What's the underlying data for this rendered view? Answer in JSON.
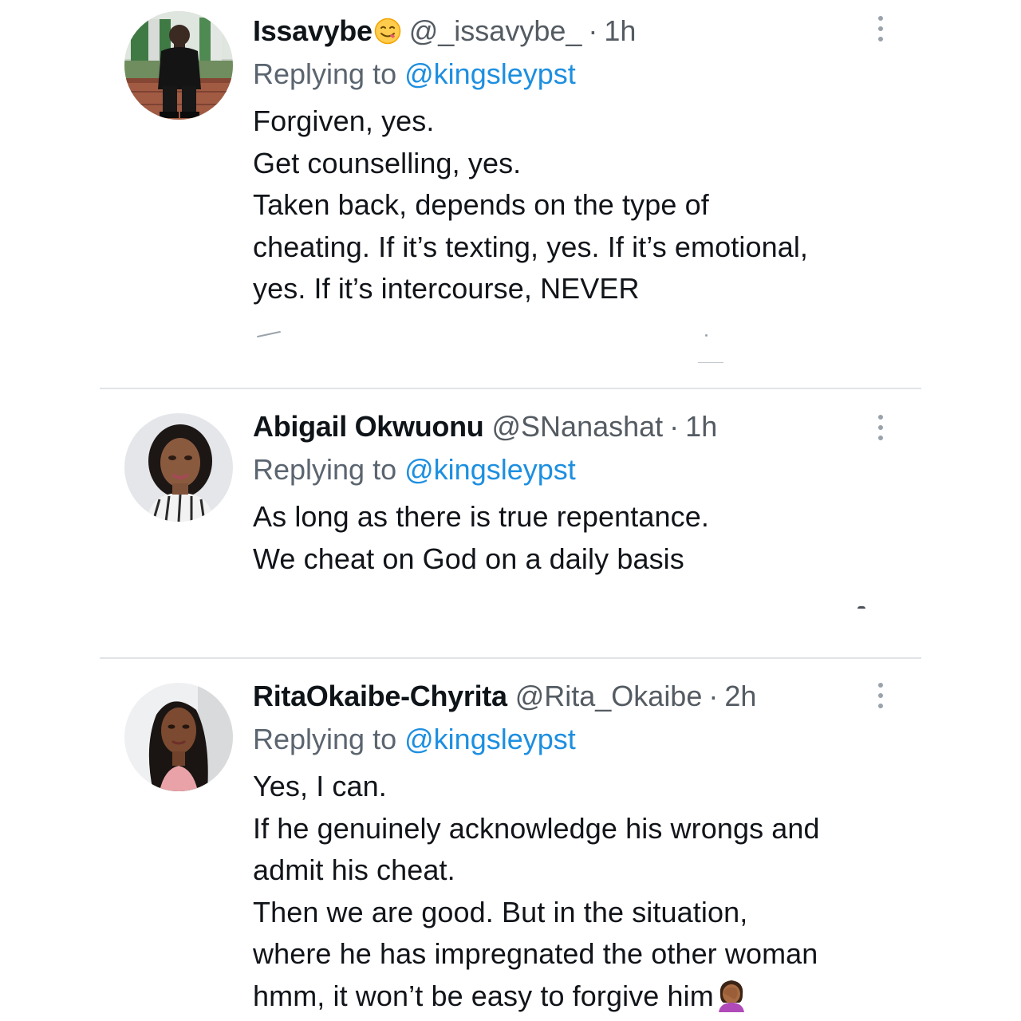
{
  "tweets": [
    {
      "display_name": "Issavybe",
      "name_emoji": "face-savoring-food-emoji",
      "handle": "@_issavybe_",
      "separator": "·",
      "time": "1h",
      "reply_prefix": "Replying to",
      "reply_target": "@kingsleypst",
      "body": [
        "Forgiven, yes.",
        "Get counselling, yes.",
        "Taken back, depends on the type of",
        "cheating. If it’s texting, yes. If it’s emotional,",
        "yes. If it’s intercourse, NEVER"
      ],
      "avatar_icon": "man-in-black-suit-avatar",
      "more_icon": "more-options-icon"
    },
    {
      "display_name": "Abigail Okwuonu",
      "handle": "@SNanashat",
      "separator": "·",
      "time": "1h",
      "reply_prefix": "Replying to",
      "reply_target": "@kingsleypst",
      "body": [
        "As long as there is true repentance.",
        "We cheat on God on a daily  basis"
      ],
      "avatar_icon": "woman-portrait-avatar",
      "more_icon": "more-options-icon"
    },
    {
      "display_name": "RitaOkaibe-Chyrita",
      "handle": "@Rita_Okaibe",
      "separator": "·",
      "time": "2h",
      "reply_prefix": "Replying to",
      "reply_target": "@kingsleypst",
      "body": [
        "Yes, I can.",
        "If he genuinely acknowledge his wrongs and",
        "admit his cheat.",
        "Then we are good. But in the situation,",
        "where he has impregnated the other woman",
        "hmm, it won’t be easy to forgive him"
      ],
      "body_emoji": "woman-facepalming-emoji",
      "avatar_icon": "woman-long-hair-avatar",
      "more_icon": "more-options-icon"
    }
  ],
  "colors": {
    "text": "#111419",
    "secondary": "#545b62",
    "link": "#1d8fe0",
    "divider": "#e1e4e7"
  }
}
